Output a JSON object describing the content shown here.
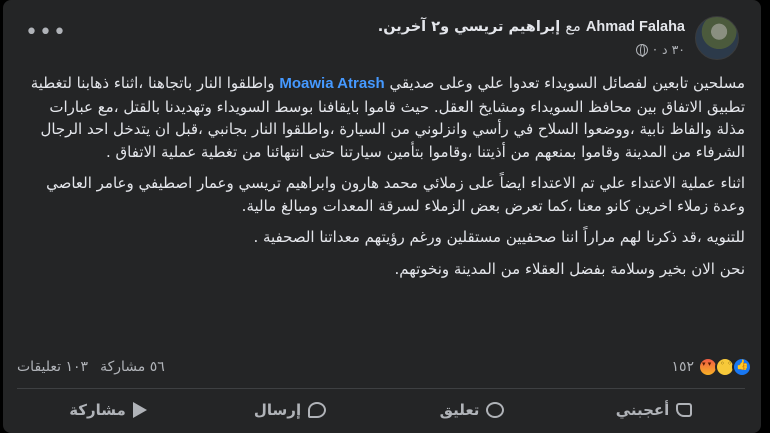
{
  "post": {
    "author": "Ahmad Falaha",
    "with_word": "مع",
    "tagged": "إبراهيم تريسي",
    "and_others": "و٢ آخرين.",
    "time": "٣٠ د",
    "body": {
      "p1_pre": "مسلحين تابعين لفصائل السويداء تعدوا علي وعلى صديقي ",
      "mention": "Moawia Atrash",
      "p1_post": " واطلقوا النار باتجاهنا ،اثناء ذهابنا لتغطية تطبيق الاتفاق بين محافظ السويداء ومشايخ العقل. حيث قاموا بايقافنا بوسط السويداء وتهديدنا بالقتل ،مع عبارات مذلة والفاظ نابية ،ووضعوا السلاح في رأسي وانزلوني من السيارة ،واطلقوا النار بجانبي ،قبل ان يتدخل احد الرجال الشرفاء من المدينة وقاموا بمنعهم من أذيتنا ،وقاموا بتأمين سيارتنا حتى انتهائنا من تغطية عملية الاتفاق .",
      "p2": "اثناء عملية الاعتداء علي تم الاعتداء ايضاً على زملائي محمد هارون وابراهيم تريسي وعمار اصطيفي وعامر العاصي وعدة زملاء اخرين كانو معنا ،كما تعرض بعض الزملاء لسرقة المعدات ومبالغ مالية.",
      "p3": "للتنويه ،قد ذكرنا لهم مراراً اننا صحفيين مستقلين ورغم رؤيتهم معداتنا الصحفية .",
      "p4": "نحن الان بخير وسلامة بفضل العقلاء من المدينة ونخوتهم."
    },
    "reactions_count": "١٥٢",
    "comments_count": "١٠٣ تعليقات",
    "shares_count": "٥٦ مشاركة"
  },
  "actions": {
    "like": "أعجبني",
    "comment": "تعليق",
    "send": "إرسال",
    "share": "مشاركة"
  },
  "colors": {
    "background": "#242526",
    "text": "#e4e6eb",
    "secondary": "#b0b3b8",
    "mention": "#4599ff"
  }
}
